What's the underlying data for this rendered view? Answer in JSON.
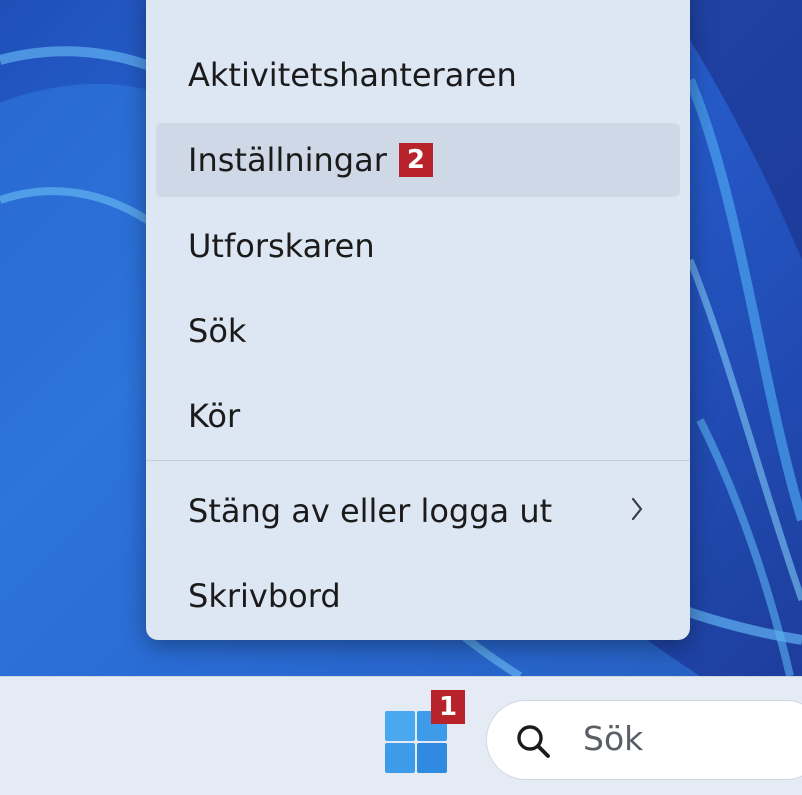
{
  "menu": {
    "items": [
      {
        "label": "Aktivitetshanteraren"
      },
      {
        "label": "Inställningar"
      },
      {
        "label": "Utforskaren"
      },
      {
        "label": "Sök"
      },
      {
        "label": "Kör"
      },
      {
        "label": "Stäng av eller logga ut"
      },
      {
        "label": "Skrivbord"
      }
    ]
  },
  "badges": {
    "start": "1",
    "settings": "2"
  },
  "taskbar": {
    "search_label": "Sök"
  },
  "colors": {
    "badge": "#b8222a",
    "menu_bg": "#dde6f3",
    "taskbar_bg": "#e4ebf5",
    "start_icon": "#3d9be9"
  },
  "icons": {
    "start": "windows-logo-icon",
    "search": "search-icon",
    "submenu": "chevron-right-icon"
  }
}
